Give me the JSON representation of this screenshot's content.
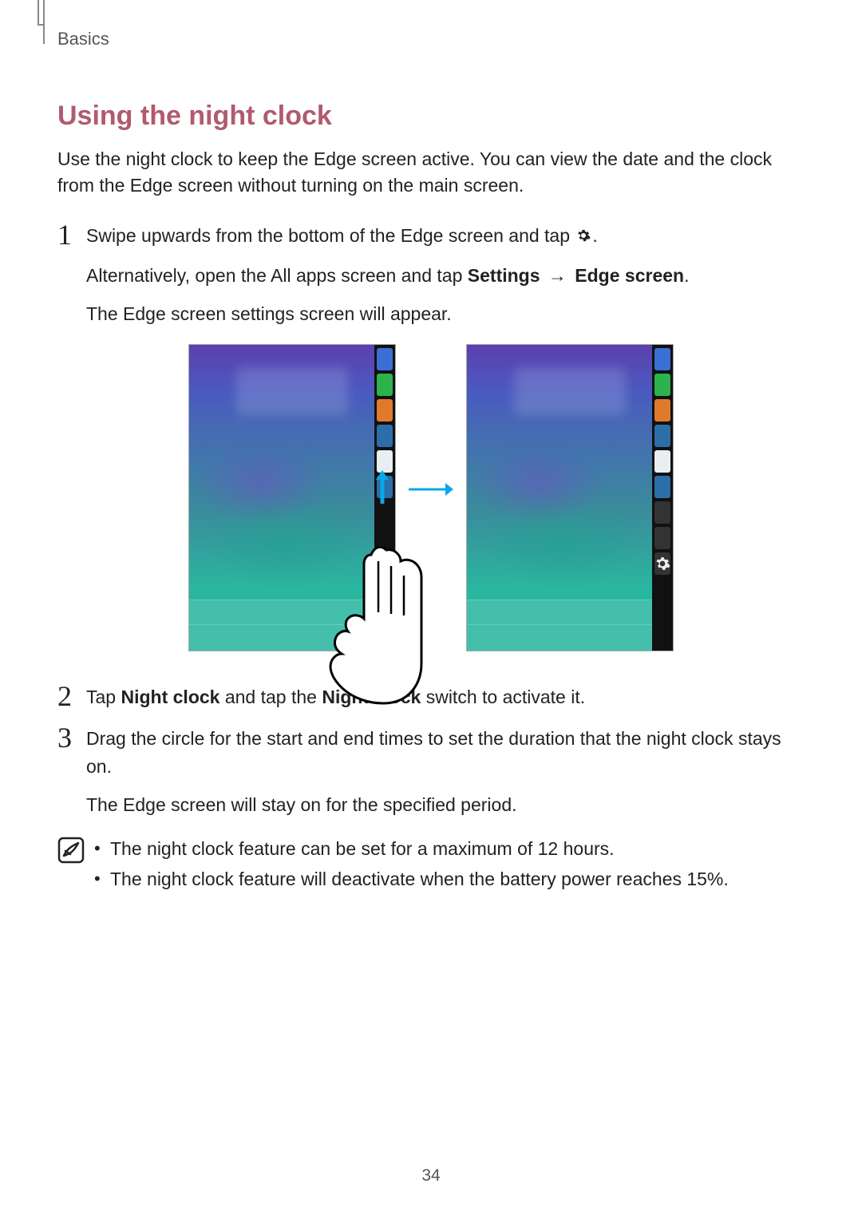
{
  "header": {
    "section": "Basics"
  },
  "heading": "Using the night clock",
  "intro": "Use the night clock to keep the Edge screen active. You can view the date and the clock from the Edge screen without turning on the main screen.",
  "steps": {
    "s1": {
      "num": "1",
      "line1a": "Swipe upwards from the bottom of the Edge screen and tap ",
      "line1b": ".",
      "line2a": "Alternatively, open the All apps screen and tap ",
      "settings": "Settings",
      "arrow": "→",
      "edge_screen": "Edge screen",
      "line2b": ".",
      "line3": "The Edge screen settings screen will appear."
    },
    "s2": {
      "num": "2",
      "a": "Tap ",
      "b": "Night clock",
      "c": " and tap the ",
      "d": "Night clock",
      "e": " switch to activate it."
    },
    "s3": {
      "num": "3",
      "p1": "Drag the circle for the start and end times to set the duration that the night clock stays on.",
      "p2": "The Edge screen will stay on for the specified period."
    }
  },
  "notes": {
    "n1": "The night clock feature can be set for a maximum of 12 hours.",
    "n2": "The night clock feature will deactivate when the battery power reaches 15%."
  },
  "figure": {
    "edge_icons": [
      "star",
      "phone",
      "contact",
      "mail",
      "browser",
      "camera"
    ]
  },
  "page_number": "34"
}
